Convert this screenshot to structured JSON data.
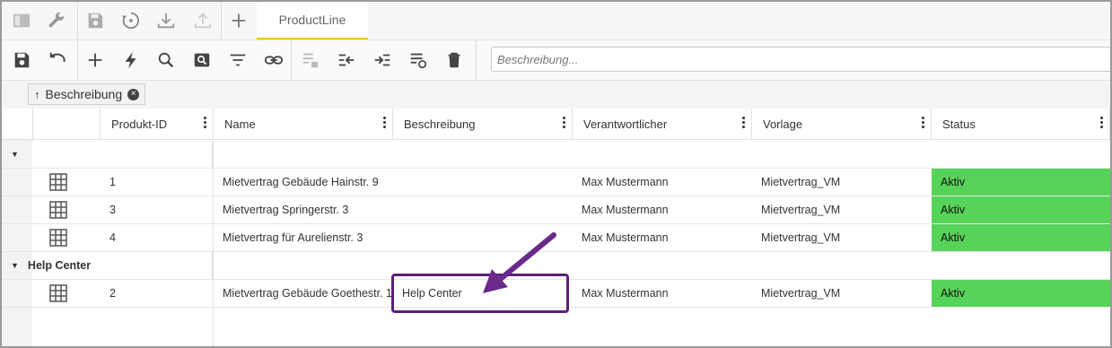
{
  "topbar": {
    "icons": [
      "sidebar-icon",
      "wrench-icon",
      "save-icon",
      "history-icon",
      "download-icon",
      "upload-icon",
      "plus-icon"
    ],
    "tab_label": "ProductLine"
  },
  "toolbar": {
    "icons": [
      "save-icon",
      "undo-icon",
      "plus-icon",
      "lightning-icon",
      "search-icon",
      "zoom-box-icon",
      "filter-icon",
      "link-icon",
      "save-list-icon",
      "indent-left-icon",
      "indent-right-icon",
      "history-list-icon",
      "trash-icon"
    ],
    "search_placeholder": "Beschreibung..."
  },
  "filter_chip": {
    "arrow": "↑",
    "label": "Beschreibung",
    "remove": "×"
  },
  "columns": [
    "Produkt-ID",
    "Name",
    "Beschreibung",
    "Verantwortlicher",
    "Vorlage",
    "Status"
  ],
  "groups": [
    {
      "label": "",
      "rows": [
        {
          "id": "1",
          "name": "Mietvertrag Gebäude Hainstr. 9",
          "beschreibung": "",
          "verantwortlicher": "Max Mustermann",
          "vorlage": "Mietvertrag_VM",
          "status": "Aktiv"
        },
        {
          "id": "3",
          "name": "Mietvertrag Springerstr. 3",
          "beschreibung": "",
          "verantwortlicher": "Max Mustermann",
          "vorlage": "Mietvertrag_VM",
          "status": "Aktiv"
        },
        {
          "id": "4",
          "name": "Mietvertrag für Aurelienstr. 3",
          "beschreibung": "",
          "verantwortlicher": "Max Mustermann",
          "vorlage": "Mietvertrag_VM",
          "status": "Aktiv"
        }
      ]
    },
    {
      "label": "Help Center",
      "rows": [
        {
          "id": "2",
          "name": "Mietvertrag Gebäude Goethestr. 1",
          "beschreibung": "Help Center",
          "verantwortlicher": "Max Mustermann",
          "vorlage": "Mietvertrag_VM",
          "status": "Aktiv"
        }
      ]
    }
  ],
  "colors": {
    "status_active": "#57d35a",
    "tab_underline": "#f0c030",
    "annotation": "#5c1f7a"
  }
}
